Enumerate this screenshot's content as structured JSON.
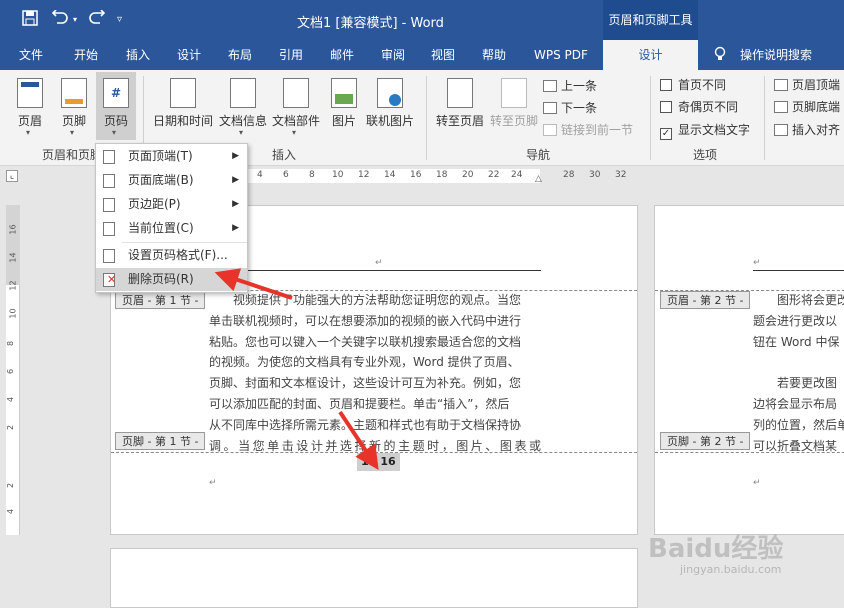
{
  "window": {
    "title": "文档1 [兼容模式]  -  Word",
    "context_tool": "页眉和页脚工具"
  },
  "tabs": [
    "文件",
    "开始",
    "插入",
    "设计",
    "布局",
    "引用",
    "邮件",
    "审阅",
    "视图",
    "帮助",
    "WPS PDF",
    "设计"
  ],
  "tell_me": "操作说明搜索",
  "ribbon": {
    "hf_group": {
      "header": "页眉",
      "footer": "页脚",
      "page_number": "页码",
      "label": "页眉和页脚"
    },
    "insert_group": {
      "datetime": "日期和时间",
      "docinfo": "文档信息",
      "docparts": "文档部件",
      "picture": "图片",
      "online_picture": "联机图片",
      "label": "插入"
    },
    "nav_group": {
      "goto_header": "转至页眉",
      "goto_footer": "转至页脚",
      "prev": "上一条",
      "next": "下一条",
      "link_prev": "链接到前一节",
      "label": "导航"
    },
    "options_group": {
      "diff_first": "首页不同",
      "diff_odd_even": "奇偶页不同",
      "show_text": "显示文档文字",
      "label": "选项"
    },
    "position_group": {
      "header_top": "页眉顶端",
      "footer_bottom": "页脚底端",
      "insert_align": "插入对齐"
    }
  },
  "ruler": {
    "h_ticks": [
      "4",
      "6",
      "8",
      "10",
      "12",
      "14",
      "16",
      "18",
      "20",
      "22",
      "24",
      "28",
      "30",
      "32"
    ],
    "v_ticks": [
      "16",
      "14",
      "12",
      "10",
      "8",
      "6",
      "4",
      "2",
      "2",
      "4"
    ]
  },
  "page_number_menu": {
    "items": [
      {
        "label": "页面顶端(T)",
        "submenu": true
      },
      {
        "label": "页面底端(B)",
        "submenu": true
      },
      {
        "label": "页边距(P)",
        "submenu": true
      },
      {
        "label": "当前位置(C)",
        "submenu": true
      },
      {
        "label": "设置页码格式(F)...",
        "submenu": false
      },
      {
        "label": "删除页码(R)",
        "submenu": false
      }
    ]
  },
  "page1": {
    "header_label": "页眉 - 第 1 节 -",
    "footer_label": "页脚 - 第 1 节 -",
    "body_lines": [
      "视频提供了功能强大的方法帮助您证明您的观点。当您",
      "单击联机视频时，可以在想要添加的视频的嵌入代码中进行",
      "粘贴。您也可以键入一个关键字以联机搜索最适合您的文档",
      "的视频。为使您的文档具有专业外观，Word 提供了页眉、",
      "页脚、封面和文本框设计，这些设计可互为补充。例如，您",
      "可以添加匹配的封面、页眉和提要栏。单击“插入”，然后",
      "从不同库中选择所需元素。主题和样式也有助于文档保持协",
      "调。当您单击设计并选择新的主题时，图片、图表或 SmartArt"
    ],
    "page_number": "1 / 16"
  },
  "page2": {
    "header_label": "页眉 - 第 2 节 -",
    "footer_label": "页脚 - 第 2 节 -",
    "body_lines": [
      "图形将会更改",
      "题会进行更改以",
      "钮在 Word 中保",
      "",
      "若要更改图",
      "边将会显示布局",
      "列的位置，然后单",
      "可以折叠文档某"
    ]
  },
  "watermark": {
    "brand": "Baidu经验",
    "url": "jingyan.baidu.com"
  },
  "colors": {
    "word_blue": "#2b579a",
    "annotation_red": "#e8332b"
  }
}
